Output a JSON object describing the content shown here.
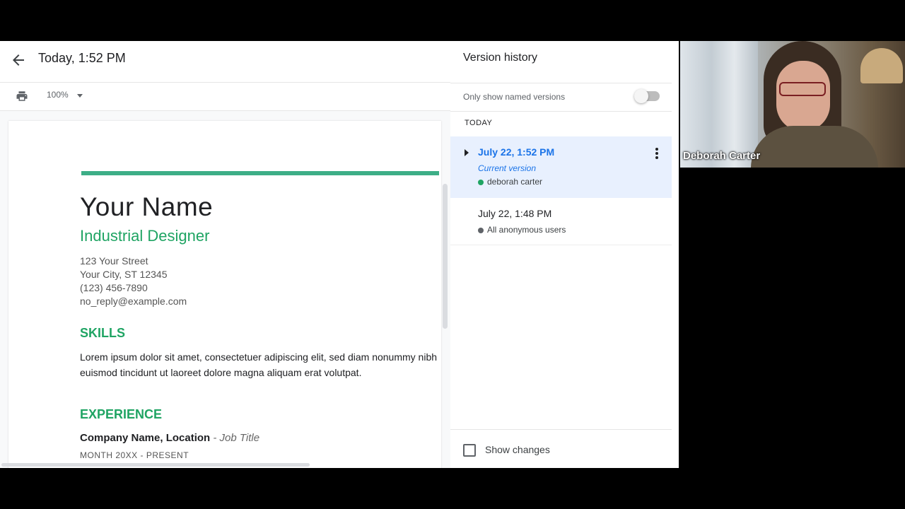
{
  "doc": {
    "title": "Today, 1:52 PM",
    "zoom": "100%",
    "page": {
      "name": "Your Name",
      "role": "Industrial Designer",
      "address_lines": [
        "123 Your Street",
        "Your City, ST 12345",
        "(123) 456-7890",
        "no_reply@example.com"
      ],
      "skills_heading": "SKILLS",
      "skills_text": "Lorem ipsum dolor sit amet, consectetuer adipiscing elit, sed diam nonummy nibh euismod tincidunt ut laoreet dolore magna aliquam erat volutpat.",
      "experience_heading": "EXPERIENCE",
      "company": "Company Name,  Location",
      "job_title": "- Job Title",
      "dates": "MONTH 20XX - PRESENT"
    }
  },
  "version_history": {
    "title": "Version history",
    "named_label": "Only show named versions",
    "named_enabled": false,
    "group_label": "TODAY",
    "versions": [
      {
        "date": "July 22, 1:52 PM",
        "current": "Current version",
        "user": "deborah carter",
        "dot_color": "#1fa463"
      },
      {
        "date": "July 22, 1:48 PM",
        "user": "All anonymous users",
        "dot_color": "#5f6368"
      }
    ],
    "show_changes_label": "Show changes",
    "show_changes_checked": false
  },
  "video": {
    "participant_name": "Deborah Carter"
  },
  "colors": {
    "accent_green": "#1fa463",
    "accent_blue": "#1a73e8",
    "selected_bg": "#e8f0fe"
  }
}
